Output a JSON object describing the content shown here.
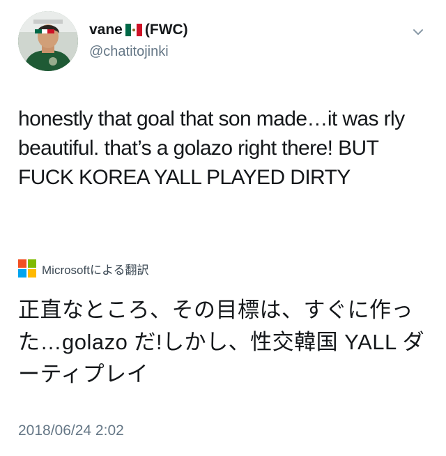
{
  "user": {
    "display_name": "vane",
    "display_suffix": "(FWC)",
    "handle": "@chatitojinki"
  },
  "tweet": {
    "text": "honestly that goal that son made…it was rly beautiful. that’s a golazo right there! BUT FUCK KOREA YALL PLAYED DIRTY",
    "timestamp": "2018/06/24 2:02"
  },
  "translation": {
    "label": "Microsoftによる翻訳",
    "text": "正直なところ、その目標は、すぐに作った…golazo だ!しかし、性交韓国 YALL ダーティプレイ"
  },
  "icons": {
    "avatar": "profile-photo",
    "flag": "mexico-flag-icon",
    "menu": "chevron-down-icon",
    "translator": "microsoft-logo-icon"
  },
  "colors": {
    "text_primary": "#14171a",
    "text_secondary": "#657786",
    "flag_green": "#006847",
    "flag_red": "#ce1126",
    "ms_red": "#f25022",
    "ms_green": "#7fba00",
    "ms_blue": "#00a4ef",
    "ms_yellow": "#ffb900"
  }
}
